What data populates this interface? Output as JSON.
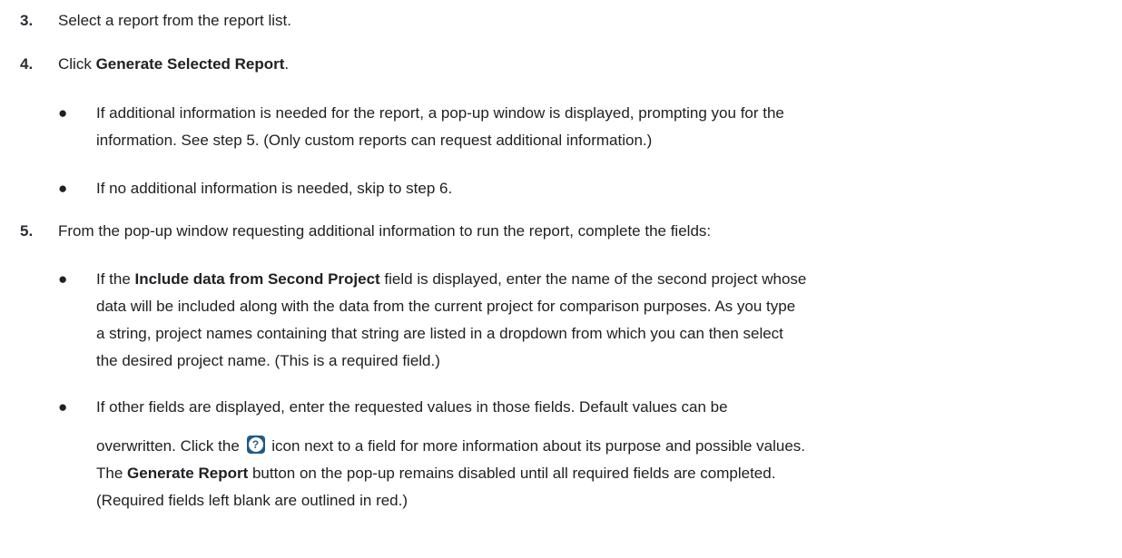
{
  "steps": {
    "s3": {
      "num": "3.",
      "text": "Select a report from the report list."
    },
    "s4": {
      "num": "4.",
      "pre": "Click ",
      "bold": "Generate Selected Report",
      "post": "."
    },
    "s4_bullets": {
      "b1_line1": "If additional information is needed for the report, a pop-up window is displayed, prompting you for the",
      "b1_line2": "information. See step 5. (Only custom reports can request additional information.)",
      "b2_line1": "If no additional information is needed, skip to step 6."
    },
    "s5": {
      "num": "5.",
      "text": "From the pop-up window requesting additional information to run the report, complete the fields:"
    },
    "s5_bullets": {
      "b1_pre": "If the ",
      "b1_bold": "Include data from Second Project",
      "b1_post": " field is displayed, enter the name of the second project whose",
      "b1_line2": "data will be included along with the data from the current project for comparison purposes. As you type",
      "b1_line3": "a string, project names containing that string are listed in a dropdown from which you can then select",
      "b1_line4": "the desired project name. (This is a required field.)",
      "b2_line1": "If other fields are displayed, enter the requested values in those fields. Default values can be",
      "b2_line2_pre": "overwritten. Click the ",
      "b2_line2_post": " icon next to a field for more information about its purpose and possible values.",
      "b2_line3_pre": "The ",
      "b2_line3_bold": "Generate Report",
      "b2_line3_post": " button on the pop-up remains disabled until all required fields are completed.",
      "b2_line4": "(Required fields left blank are outlined in red.)"
    }
  },
  "bullet_char": "●",
  "help_icon": {
    "name": "help-question-icon",
    "glyph": "?",
    "color": "#1f5a8a"
  }
}
